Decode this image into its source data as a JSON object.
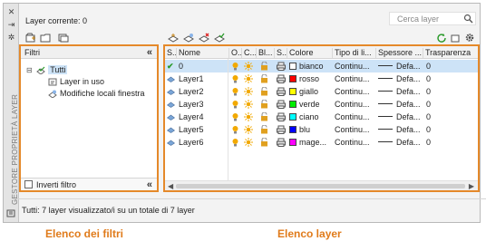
{
  "palette": {
    "title_vertical": "GESTORE PROPRIETÀ LAYER",
    "current_layer": "Layer corrente: 0",
    "search_placeholder": "Cerca layer"
  },
  "filters": {
    "header": "Filtri",
    "collapse_glyph": "«",
    "tree": [
      {
        "label": "Tutti",
        "icon": "filter-all-icon",
        "level": 0
      },
      {
        "label": "Layer in uso",
        "icon": "filter-used-icon",
        "level": 1
      },
      {
        "label": "Modifiche locali finestra",
        "icon": "filter-viewport-icon",
        "level": 1
      }
    ],
    "invert_label": "Inverti filtro"
  },
  "layers": {
    "columns": [
      "S...",
      "Nome",
      "O...",
      "C...",
      "Bl...",
      "S...",
      "Colore",
      "Tipo di li...",
      "Spessore ...",
      "Trasparenza"
    ],
    "rows": [
      {
        "status": "✔",
        "name": "0",
        "color_name": "bianco",
        "color_hex": "#ffffff",
        "linetype": "Continu...",
        "lineweight": "Defa...",
        "transparency": "0",
        "selected": true
      },
      {
        "status": "",
        "name": "Layer1",
        "color_name": "rosso",
        "color_hex": "#ff0000",
        "linetype": "Continu...",
        "lineweight": "Defa...",
        "transparency": "0",
        "selected": false
      },
      {
        "status": "",
        "name": "Layer2",
        "color_name": "giallo",
        "color_hex": "#ffff00",
        "linetype": "Continu...",
        "lineweight": "Defa...",
        "transparency": "0",
        "selected": false
      },
      {
        "status": "",
        "name": "Layer3",
        "color_name": "verde",
        "color_hex": "#00ee00",
        "linetype": "Continu...",
        "lineweight": "Defa...",
        "transparency": "0",
        "selected": false
      },
      {
        "status": "",
        "name": "Layer4",
        "color_name": "ciano",
        "color_hex": "#00ffff",
        "linetype": "Continu...",
        "lineweight": "Defa...",
        "transparency": "0",
        "selected": false
      },
      {
        "status": "",
        "name": "Layer5",
        "color_name": "blu",
        "color_hex": "#0000ff",
        "linetype": "Continu...",
        "lineweight": "Defa...",
        "transparency": "0",
        "selected": false
      },
      {
        "status": "",
        "name": "Layer6",
        "color_name": "mage...",
        "color_hex": "#ff00ff",
        "linetype": "Continu...",
        "lineweight": "Defa...",
        "transparency": "0",
        "selected": false
      }
    ]
  },
  "status_text": "Tutti: 7 layer visualizzato/i su un totale di 7 layer",
  "captions": {
    "filters": "Elenco dei filtri",
    "layers": "Elenco layer"
  },
  "colors": {
    "accent_orange": "#e5892a",
    "selection": "#cde3f7",
    "bulb": "#f2a900",
    "sun": "#f2a900",
    "lock": "#e0a020"
  }
}
